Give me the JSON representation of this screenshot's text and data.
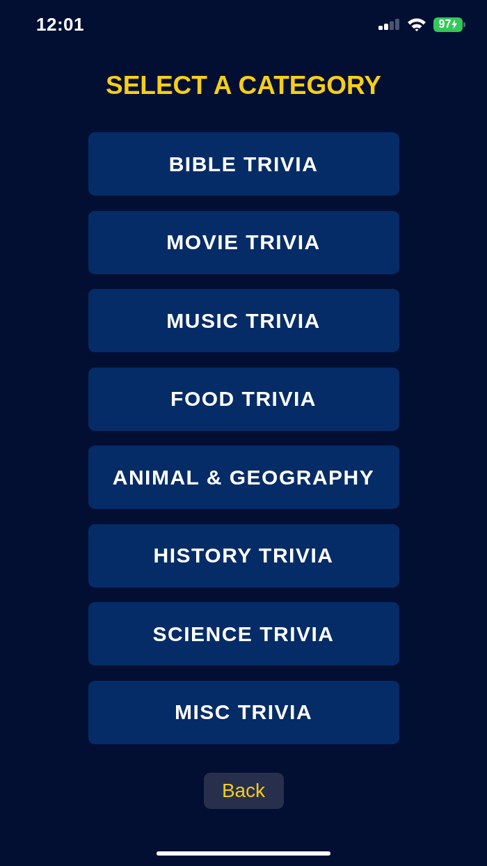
{
  "status_bar": {
    "time": "12:01",
    "battery": "97",
    "charging": true
  },
  "title": "SELECT A CATEGORY",
  "categories": [
    "BIBLE TRIVIA",
    "MOVIE TRIVIA",
    "MUSIC TRIVIA",
    "FOOD TRIVIA",
    "ANIMAL & GEOGRAPHY",
    "HISTORY TRIVIA",
    "SCIENCE TRIVIA",
    "MISC TRIVIA"
  ],
  "back_button": "Back"
}
